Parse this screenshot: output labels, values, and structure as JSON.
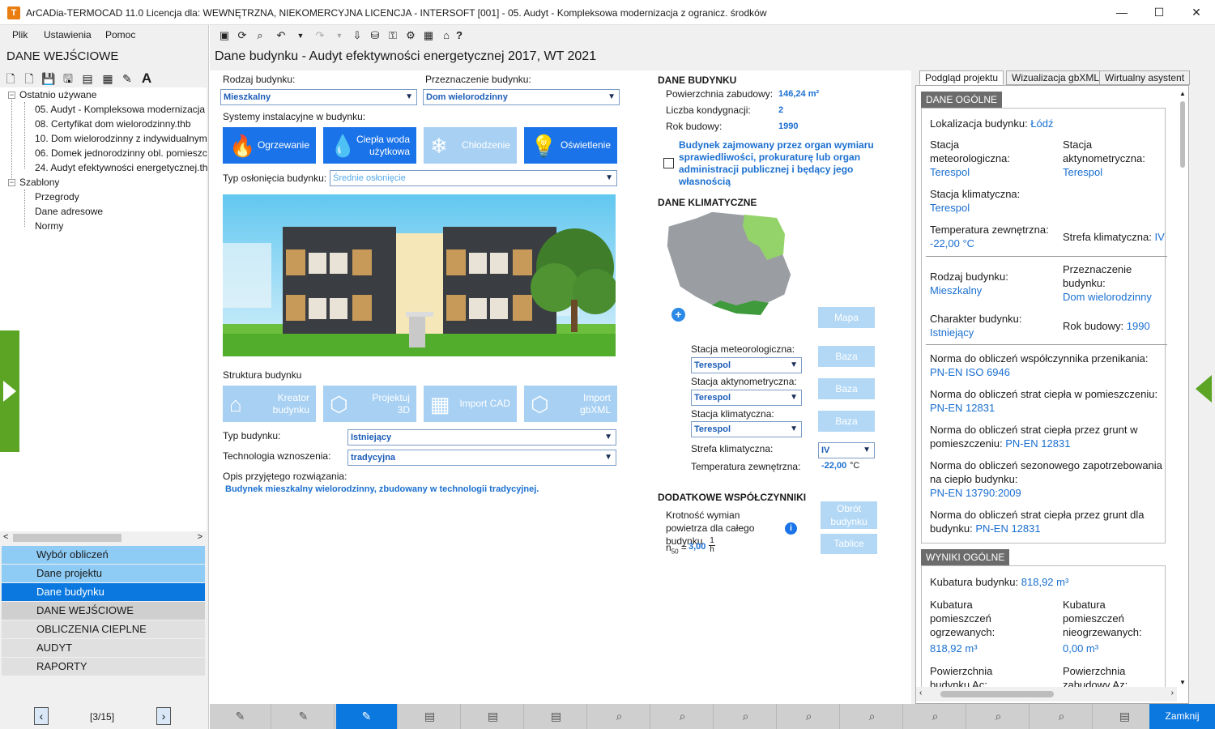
{
  "window": {
    "title": "ArCADia-TERMOCAD 11.0 Licencja dla: WEWNĘTRZNA, NIEKOMERCYJNA LICENCJA - INTERSOFT [001] - 05. Audyt - Kompleksowa modernizacja z ogranicz. środków",
    "minimize": "—",
    "maximize": "☐",
    "close": "✕"
  },
  "menu": {
    "file": "Plik",
    "settings": "Ustawienia",
    "help": "Pomoc"
  },
  "left": {
    "heading": "DANE WEJŚCIOWE",
    "tree": {
      "recent_label": "Ostatnio używane",
      "recent": [
        "05. Audyt - Kompleksowa modernizacja",
        "08. Certyfikat dom wielorodzinny.thb",
        "10. Dom wielorodzinny z indywidualnym",
        "06. Domek jednorodzinny obl. pomieszc",
        "24. Audyt efektywności energetycznej.th"
      ],
      "templates_label": "Szablony",
      "templates": [
        "Przegrody",
        "Dane adresowe",
        "Normy"
      ]
    },
    "nav": [
      "Wybór obliczeń",
      "Dane projektu",
      "Dane budynku",
      "DANE WEJŚCIOWE",
      "OBLICZENIA CIEPLNE",
      "AUDYT",
      "RAPORTY"
    ],
    "pager": "[3/15]"
  },
  "subtitle": "Dane budynku - Audyt efektywności energetycznej 2017, WT 2021",
  "form": {
    "building_type_label": "Rodzaj budynku:",
    "building_type": "Mieszkalny",
    "purpose_label": "Przeznaczenie budynku:",
    "purpose": "Dom wielorodzinny",
    "systems_label": "Systemy instalacyjne w budynku:",
    "systems": [
      {
        "icon": "flame-icon",
        "label": "Ogrzewanie",
        "enabled": true
      },
      {
        "icon": "water-drop-icon",
        "label": "Ciepła woda użytkowa",
        "enabled": true
      },
      {
        "icon": "snowflake-icon",
        "label": "Chłodzenie",
        "enabled": false
      },
      {
        "icon": "lightbulb-icon",
        "label": "Oświetlenie",
        "enabled": true
      }
    ],
    "shading_label": "Typ osłonięcia budynku:",
    "shading": "Średnie osłonięcie",
    "structure_label": "Struktura budynku",
    "structure_buttons": [
      {
        "icon": "house-wizard-icon",
        "label": "Kreator budynku"
      },
      {
        "icon": "project-3d-icon",
        "label": "Projektuj 3D"
      },
      {
        "icon": "cad-import-icon",
        "label": "Import CAD"
      },
      {
        "icon": "gbxml-import-icon",
        "label": "Import gbXML"
      }
    ],
    "building_kind_label": "Typ budynku:",
    "building_kind": "Istniejący",
    "technology_label": "Technologia wznoszenia:",
    "technology": "tradycyjna",
    "description_label": "Opis przyjętego rozwiązania:",
    "description": "Budynek mieszkalny wielorodzinny, zbudowany w technologii tradycyjnej."
  },
  "building_data": {
    "heading": "DANE BUDYNKU",
    "area_label": "Powierzchnia zabudowy:",
    "area": "146,24 m²",
    "floors_label": "Liczba kondygnacji:",
    "floors": "2",
    "year_label": "Rok budowy:",
    "year": "1990",
    "checkbox_text": "Budynek zajmowany przez organ wymiaru sprawiedliwości, prokuraturę lub organ administracji publicznej i będący jego własnością",
    "checkbox_checked": false
  },
  "climate": {
    "heading": "DANE KLIMATYCZNE",
    "map_button": "Mapa",
    "meteo_label": "Stacja meteorologiczna:",
    "meteo": "Terespol",
    "actino_label": "Stacja aktynometryczna:",
    "actino": "Terespol",
    "climatic_label": "Stacja klimatyczna:",
    "climatic": "Terespol",
    "zone_label": "Strefa klimatyczna:",
    "zone": "IV",
    "temp_label": "Temperatura zewnętrzna:",
    "temp": "-22,00",
    "temp_unit": "°C",
    "base_button": "Baza"
  },
  "extra": {
    "heading": "DODATKOWE WSPÓŁCZYNNIKI",
    "air_label": "Krotność wymian powietrza dla całego budynku",
    "n50_label": "n",
    "n50_sub": "50",
    "n50_value": "3,00",
    "n50_unit_num": "1",
    "n50_unit_den": "h",
    "rotate_button": "Obrót budynku",
    "tables_button": "Tablice"
  },
  "right": {
    "tabs": [
      "Podgląd projektu",
      "Wizualizacja gbXML",
      "Wirtualny asystent"
    ],
    "general_heading": "DANE OGÓLNE",
    "location_label": "Lokalizacja budynku:",
    "location": "Łódź",
    "meteo_label": "Stacja meteorologiczna:",
    "meteo": "Terespol",
    "actino_label": "Stacja aktynometryczna:",
    "actino": "Terespol",
    "climatic_label": "Stacja klimatyczna:",
    "climatic": "Terespol",
    "temp_label": "Temperatura zewnętrzna:",
    "temp": "-22,00 °C",
    "zone_label": "Strefa klimatyczna:",
    "zone": "IV",
    "kind_label": "Rodzaj budynku:",
    "kind": "Mieszkalny",
    "purpose_label": "Przeznaczenie budynku:",
    "purpose": "Dom wielorodzinny",
    "char_label": "Charakter budynku:",
    "char": "Istniejący",
    "year_label": "Rok budowy:",
    "year": "1990",
    "norms": [
      {
        "label": "Norma do obliczeń współczynnika przenikania:",
        "value": "PN-EN ISO 6946"
      },
      {
        "label": "Norma do obliczeń strat ciepła w pomieszczeniu:",
        "value": "PN-EN 12831"
      },
      {
        "label": "Norma do obliczeń strat ciepła przez grunt w pomieszczeniu:",
        "value": "PN-EN 12831"
      },
      {
        "label": "Norma do obliczeń sezonowego zapotrzebowania na ciepło budynku:",
        "value": "PN-EN 13790:2009"
      },
      {
        "label": "Norma do obliczeń strat ciepła przez grunt dla budynku:",
        "value": "PN-EN 12831"
      }
    ],
    "results_heading": "WYNIKI OGÓLNE",
    "volume_label": "Kubatura budynku:",
    "volume": "818,92 m³",
    "heated_label": "Kubatura pomieszczeń ogrzewanych:",
    "heated": "818,92 m³",
    "unheated_label": "Kubatura pomieszczeń nieogrzewanych:",
    "unheated": "0,00 m³",
    "area_ac_label": "Powierzchnia budynku Ac:",
    "area_az_label": "Powierzchnia zabudowy Az:"
  },
  "bottom": {
    "close_label": "Zamknij"
  },
  "colors": {
    "accent": "#0b78e0",
    "green": "#5ba424",
    "link": "#1a6fd0"
  }
}
